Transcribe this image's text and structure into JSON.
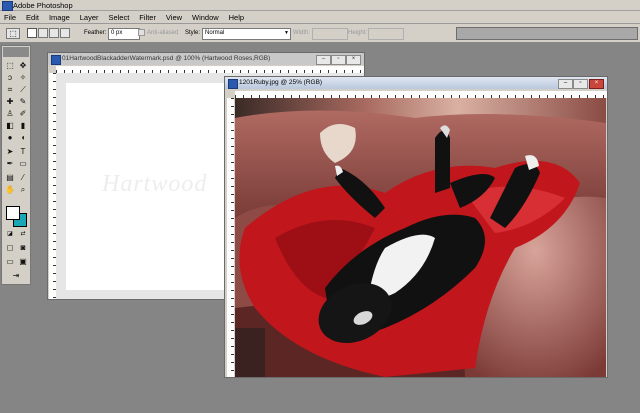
{
  "app": {
    "title": "Adobe Photoshop",
    "icon": "photoshop-app-icon"
  },
  "menu": [
    "File",
    "Edit",
    "Image",
    "Layer",
    "Select",
    "Filter",
    "View",
    "Window",
    "Help"
  ],
  "options": {
    "feather_label": "Feather:",
    "feather_value": "0 px",
    "antialiased_label": "Anti-aliased",
    "style_label": "Style:",
    "style_value": "Normal",
    "width_label": "Width:",
    "height_label": "Height:"
  },
  "doc1": {
    "title": "01HartwoodBlackadderWatermark.psd @ 100% (Hartwood Roses,RGB)",
    "watermark": "Hartwood"
  },
  "doc2": {
    "title": "1201Ruby.jpg @ 25% (RGB)"
  },
  "window_buttons": {
    "minimize": "–",
    "restore": "▫",
    "close": "×"
  },
  "colors": {
    "foreground": "#ffffff",
    "background": "#19a6b5",
    "workspace": "#858585"
  }
}
